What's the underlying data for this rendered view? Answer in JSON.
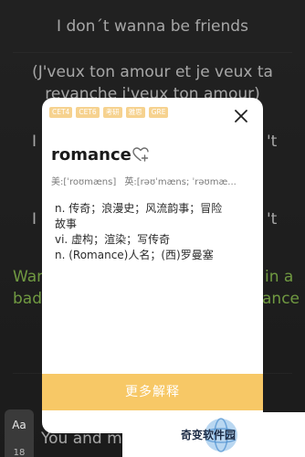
{
  "lyrics": {
    "line1": "I don´t wanna be friends",
    "line2": "(J'veux ton amour et je veux ta",
    "line3": "revanche j'veux ton amour)",
    "left_fragment_1": "I",
    "right_fragment_1": "'t",
    "left_fragment_2": "I",
    "right_fragment_2": "'t",
    "green_left_1": "Wan",
    "green_right_1": "in a",
    "green_left_2": "bad",
    "green_right_2": "ance",
    "bottom_line": "You and me"
  },
  "card": {
    "tags": [
      "CET4",
      "CET6",
      "考研",
      "雅思",
      "GRE"
    ],
    "word": "romance",
    "phonetic_us": "美:[ˈroʊmæns]",
    "phonetic_uk": "英:[rəʊˈmæns; ˈrəʊmæ...",
    "definitions": [
      "n. 传奇；浪漫史；风流韵事；冒险",
      "故事",
      "vi. 虚构；渲染；写传奇",
      "n. (Romance)人名；(西)罗曼塞"
    ],
    "more_label": "更多解释"
  },
  "font_button": {
    "label": "Aa",
    "size": "18"
  },
  "watermark": {
    "text": "奇变软件园"
  },
  "icons": {
    "close": "close-icon",
    "favorite": "heart-add-icon",
    "watermark_logo": "globe-logo-icon"
  },
  "colors": {
    "tag_bg": "#f6d28f",
    "more_button_bg": "#f7c866",
    "highlight_lyric": "#9bd45a"
  }
}
